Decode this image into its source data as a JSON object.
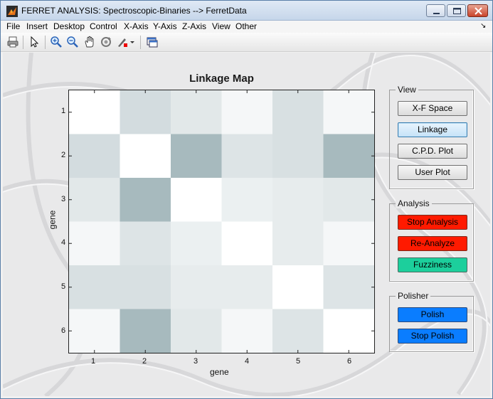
{
  "window": {
    "title": "FERRET ANALYSIS: Spectroscopic-Binaries --> FerretData"
  },
  "menu": [
    "File",
    "Insert",
    "Desktop",
    "Control",
    "X-Axis",
    "Y-Axis",
    "Z-Axis",
    "View",
    "Other"
  ],
  "toolbar": {
    "icons": [
      "print-icon",
      "select-arrow-icon",
      "zoom-in-icon",
      "zoom-out-icon",
      "pan-hand-icon",
      "rotate-icon",
      "data-cursor-icon",
      "dropdown-icon",
      "figure-window-icon"
    ]
  },
  "chart_data": {
    "type": "heatmap",
    "title": "Linkage Map",
    "xlabel": "gene",
    "ylabel": "gene",
    "x_ticks": [
      "1",
      "2",
      "3",
      "4",
      "5",
      "6"
    ],
    "y_ticks": [
      "1",
      "2",
      "3",
      "4",
      "5",
      "6"
    ],
    "colormap": {
      "low": "#ffffff",
      "high": "#9db2b7"
    },
    "values": [
      [
        0.0,
        0.45,
        0.3,
        0.1,
        0.4,
        0.1
      ],
      [
        0.45,
        0.0,
        0.9,
        0.35,
        0.4,
        0.9
      ],
      [
        0.3,
        0.9,
        0.0,
        0.2,
        0.25,
        0.3
      ],
      [
        0.1,
        0.35,
        0.2,
        0.0,
        0.25,
        0.1
      ],
      [
        0.4,
        0.4,
        0.25,
        0.25,
        0.0,
        0.35
      ],
      [
        0.1,
        0.9,
        0.3,
        0.1,
        0.35,
        0.0
      ]
    ]
  },
  "panels": {
    "view": {
      "title": "View",
      "buttons": [
        "X-F Space",
        "Linkage",
        "C.P.D. Plot",
        "User Plot"
      ],
      "active": "Linkage"
    },
    "analysis": {
      "title": "Analysis",
      "buttons": [
        "Stop Analysis",
        "Re-Analyze",
        "Fuzziness"
      ]
    },
    "polisher": {
      "title": "Polisher",
      "buttons": [
        "Polish",
        "Stop Polish"
      ]
    }
  },
  "colors": {
    "red_button": "#ff1a00",
    "teal_button": "#1ccf9c",
    "blue_button": "#0a7dff"
  }
}
